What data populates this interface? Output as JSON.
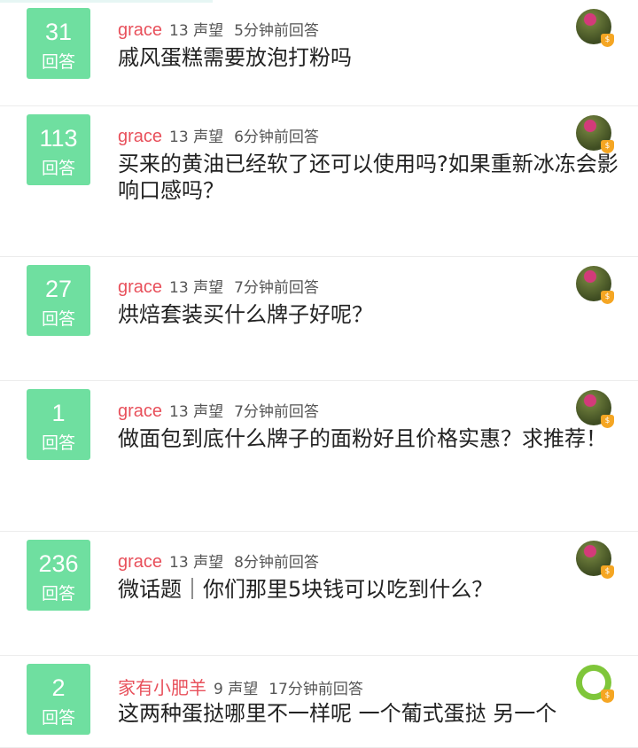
{
  "reply_label": "回答",
  "rep_label": "声望",
  "items": [
    {
      "count": "31",
      "user": "grace",
      "rep": "13",
      "time": "5分钟前回答",
      "title": "戚风蛋糕需要放泡打粉吗",
      "avatar": "flower"
    },
    {
      "count": "113",
      "user": "grace",
      "rep": "13",
      "time": "6分钟前回答",
      "title": "买来的黄油已经软了还可以使用吗?如果重新冰冻会影响口感吗？",
      "avatar": "flower"
    },
    {
      "count": "27",
      "user": "grace",
      "rep": "13",
      "time": "7分钟前回答",
      "title": "烘焙套装买什么牌子好呢？",
      "avatar": "flower"
    },
    {
      "count": "1",
      "user": "grace",
      "rep": "13",
      "time": "7分钟前回答",
      "title": "做面包到底什么牌子的面粉好且价格实惠？求推荐！",
      "avatar": "flower"
    },
    {
      "count": "236",
      "user": "grace",
      "rep": "13",
      "time": "8分钟前回答",
      "title": "微话题｜你们那里5块钱可以吃到什么？",
      "avatar": "flower"
    },
    {
      "count": "2",
      "user": "家有小肥羊",
      "rep": "9",
      "time": "17分钟前回答",
      "title": "这两种蛋挞哪里不一样呢  一个葡式蛋挞 另一个",
      "avatar": "cartoon"
    }
  ],
  "badge_glyph": "$"
}
